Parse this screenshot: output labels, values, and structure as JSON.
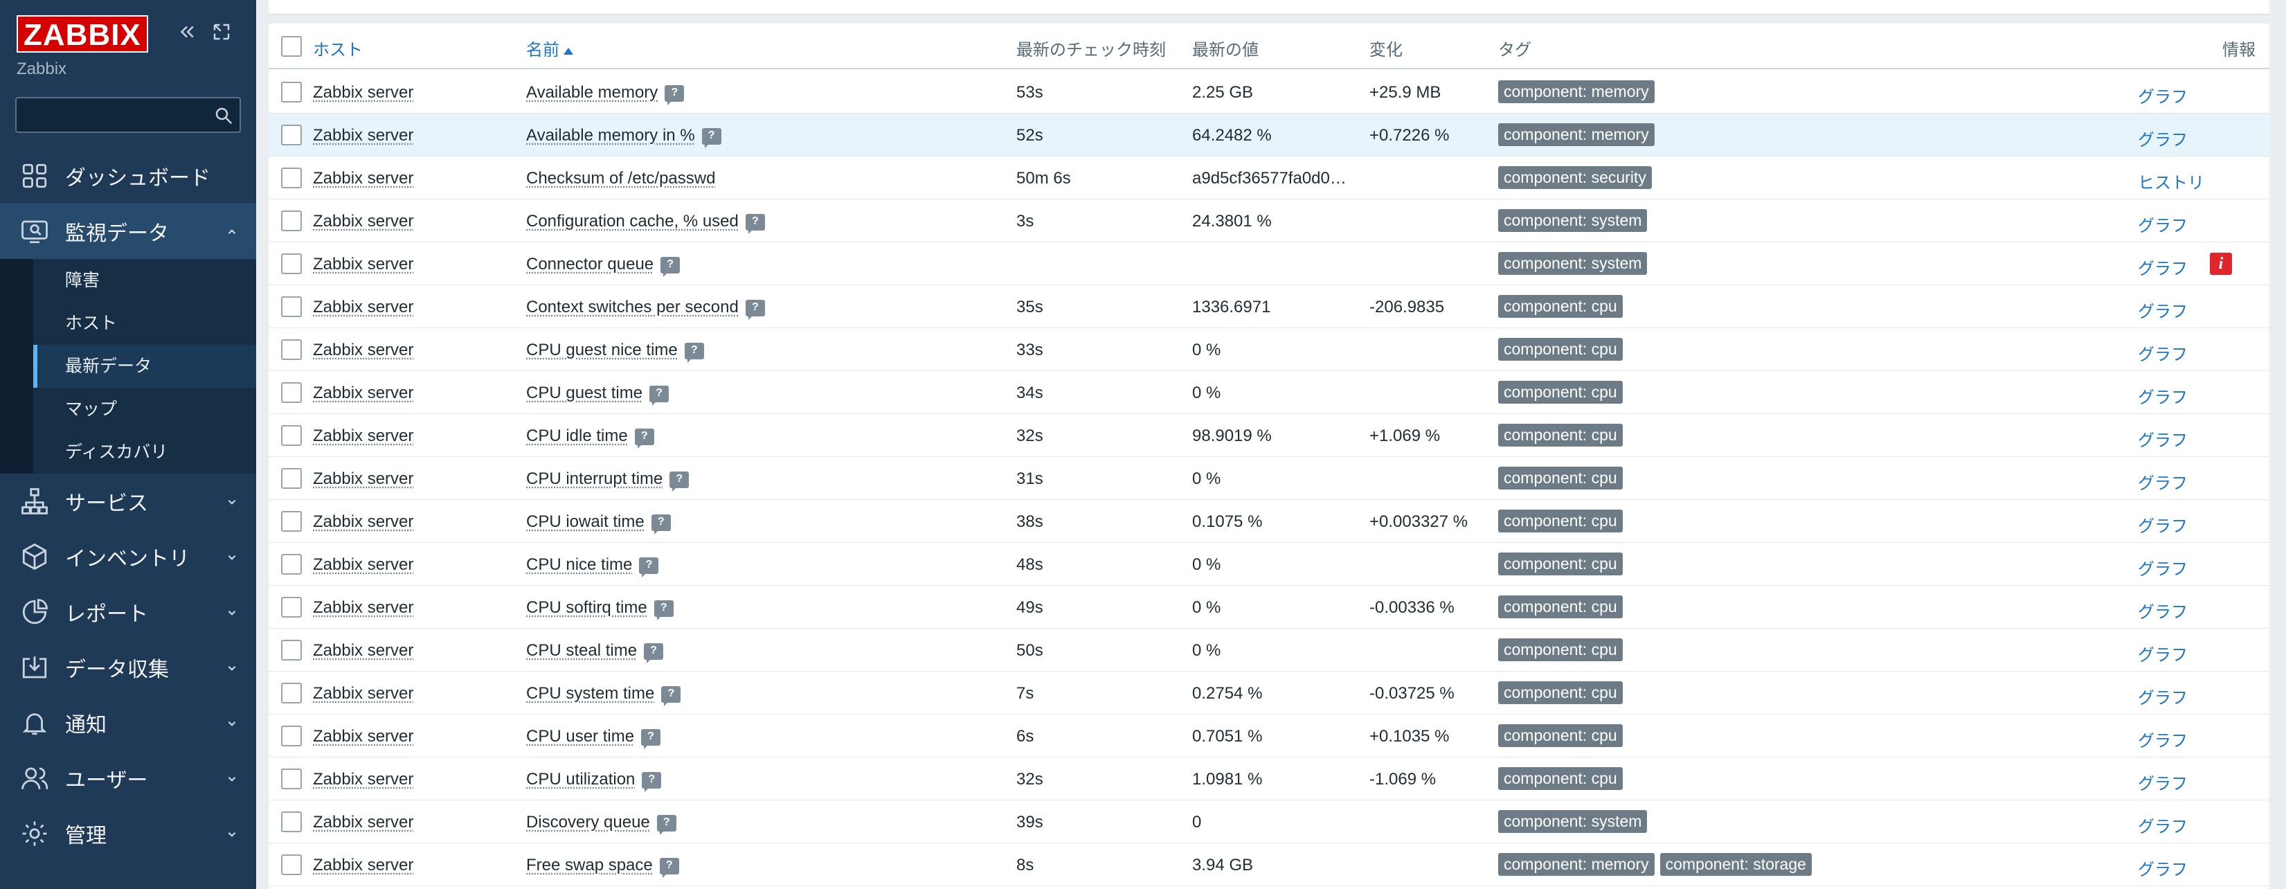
{
  "app": {
    "logo": "ZABBIX",
    "server_name": "Zabbix",
    "colors": {
      "sidebar": "#1f3a56",
      "logo": "#d40000",
      "link": "#1c74c5",
      "tag": "#6c7b86",
      "info": "#e0262c"
    }
  },
  "search": {
    "placeholder": "",
    "value": ""
  },
  "sidebar": {
    "items": [
      {
        "label": "ダッシュボード",
        "icon": "dashboard-icon"
      },
      {
        "label": "監視データ",
        "icon": "monitoring-icon",
        "expanded": true
      },
      {
        "label": "サービス",
        "icon": "services-icon"
      },
      {
        "label": "インベントリ",
        "icon": "inventory-icon"
      },
      {
        "label": "レポート",
        "icon": "reports-icon"
      },
      {
        "label": "データ収集",
        "icon": "data-collection-icon"
      },
      {
        "label": "通知",
        "icon": "bell-icon"
      },
      {
        "label": "ユーザー",
        "icon": "users-icon"
      },
      {
        "label": "管理",
        "icon": "gear-icon"
      }
    ],
    "submenu": [
      {
        "label": "障害"
      },
      {
        "label": "ホスト"
      },
      {
        "label": "最新データ",
        "active": true
      },
      {
        "label": "マップ"
      },
      {
        "label": "ディスカバリ"
      }
    ]
  },
  "table": {
    "headers": {
      "host": "ホスト",
      "name": "名前",
      "last_check": "最新のチェック時刻",
      "last_value": "最新の値",
      "change": "変化",
      "tags": "タグ",
      "info": "情報"
    },
    "sort": {
      "column": "name",
      "direction": "asc"
    },
    "rows": [
      {
        "host": "Zabbix server",
        "name": "Available memory",
        "last_check": "53s",
        "last_value": "2.25 GB",
        "change": "+25.9 MB",
        "tags": [
          "component: memory"
        ],
        "action": "グラフ"
      },
      {
        "host": "Zabbix server",
        "name": "Available memory in %",
        "last_check": "52s",
        "last_value": "64.2482 %",
        "change": "+0.7226 %",
        "tags": [
          "component: memory"
        ],
        "action": "グラフ",
        "highlight": true
      },
      {
        "host": "Zabbix server",
        "name": "Checksum of /etc/passwd",
        "last_check": "50m 6s",
        "last_value": "a9d5cf36577fa0d0…",
        "change": "",
        "tags": [
          "component: security"
        ],
        "action": "ヒストリ",
        "no_help": true
      },
      {
        "host": "Zabbix server",
        "name": "Configuration cache, % used",
        "last_check": "3s",
        "last_value": "24.3801 %",
        "change": "",
        "tags": [
          "component: system"
        ],
        "action": "グラフ"
      },
      {
        "host": "Zabbix server",
        "name": "Connector queue",
        "last_check": "",
        "last_value": "",
        "change": "",
        "tags": [
          "component: system"
        ],
        "action": "グラフ",
        "info": "i"
      },
      {
        "host": "Zabbix server",
        "name": "Context switches per second",
        "last_check": "35s",
        "last_value": "1336.6971",
        "change": "-206.9835",
        "tags": [
          "component: cpu"
        ],
        "action": "グラフ"
      },
      {
        "host": "Zabbix server",
        "name": "CPU guest nice time",
        "last_check": "33s",
        "last_value": "0 %",
        "change": "",
        "tags": [
          "component: cpu"
        ],
        "action": "グラフ"
      },
      {
        "host": "Zabbix server",
        "name": "CPU guest time",
        "last_check": "34s",
        "last_value": "0 %",
        "change": "",
        "tags": [
          "component: cpu"
        ],
        "action": "グラフ"
      },
      {
        "host": "Zabbix server",
        "name": "CPU idle time",
        "last_check": "32s",
        "last_value": "98.9019 %",
        "change": "+1.069 %",
        "tags": [
          "component: cpu"
        ],
        "action": "グラフ"
      },
      {
        "host": "Zabbix server",
        "name": "CPU interrupt time",
        "last_check": "31s",
        "last_value": "0 %",
        "change": "",
        "tags": [
          "component: cpu"
        ],
        "action": "グラフ"
      },
      {
        "host": "Zabbix server",
        "name": "CPU iowait time",
        "last_check": "38s",
        "last_value": "0.1075 %",
        "change": "+0.003327 %",
        "tags": [
          "component: cpu"
        ],
        "action": "グラフ"
      },
      {
        "host": "Zabbix server",
        "name": "CPU nice time",
        "last_check": "48s",
        "last_value": "0 %",
        "change": "",
        "tags": [
          "component: cpu"
        ],
        "action": "グラフ"
      },
      {
        "host": "Zabbix server",
        "name": "CPU softirq time",
        "last_check": "49s",
        "last_value": "0 %",
        "change": "-0.00336 %",
        "tags": [
          "component: cpu"
        ],
        "action": "グラフ"
      },
      {
        "host": "Zabbix server",
        "name": "CPU steal time",
        "last_check": "50s",
        "last_value": "0 %",
        "change": "",
        "tags": [
          "component: cpu"
        ],
        "action": "グラフ"
      },
      {
        "host": "Zabbix server",
        "name": "CPU system time",
        "last_check": "7s",
        "last_value": "0.2754 %",
        "change": "-0.03725 %",
        "tags": [
          "component: cpu"
        ],
        "action": "グラフ"
      },
      {
        "host": "Zabbix server",
        "name": "CPU user time",
        "last_check": "6s",
        "last_value": "0.7051 %",
        "change": "+0.1035 %",
        "tags": [
          "component: cpu"
        ],
        "action": "グラフ"
      },
      {
        "host": "Zabbix server",
        "name": "CPU utilization",
        "last_check": "32s",
        "last_value": "1.0981 %",
        "change": "-1.069 %",
        "tags": [
          "component: cpu"
        ],
        "action": "グラフ"
      },
      {
        "host": "Zabbix server",
        "name": "Discovery queue",
        "last_check": "39s",
        "last_value": "0",
        "change": "",
        "tags": [
          "component: system"
        ],
        "action": "グラフ"
      },
      {
        "host": "Zabbix server",
        "name": "Free swap space",
        "last_check": "8s",
        "last_value": "3.94 GB",
        "change": "",
        "tags": [
          "component: memory",
          "component: storage"
        ],
        "action": "グラフ"
      }
    ]
  }
}
